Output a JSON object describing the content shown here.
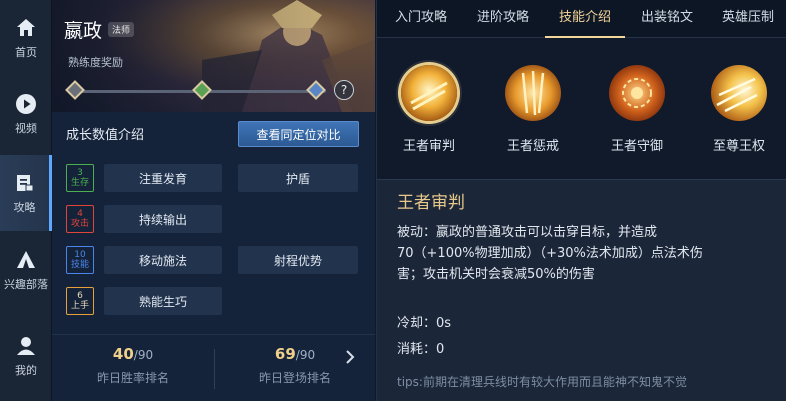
{
  "nav": {
    "items": [
      {
        "label": "首页",
        "icon": "home-icon"
      },
      {
        "label": "视频",
        "icon": "play-icon"
      },
      {
        "label": "攻略",
        "icon": "guide-icon"
      },
      {
        "label": "兴趣部落",
        "icon": "tribe-icon"
      },
      {
        "label": "我的",
        "icon": "user-icon"
      }
    ],
    "active": "攻略"
  },
  "hero": {
    "name": "嬴政",
    "role": "法师",
    "proficiency_label": "熟练度奖励",
    "help": "?"
  },
  "growth": {
    "title": "成长数值介绍",
    "compare_button": "查看同定位对比",
    "rows": [
      {
        "level": "3",
        "level_tag": "生存",
        "color": "#4caf50",
        "skills": [
          "注重发育",
          "护盾"
        ]
      },
      {
        "level": "4",
        "level_tag": "攻击",
        "color": "#e0453a",
        "skills": [
          "持续输出"
        ]
      },
      {
        "level": "10",
        "level_tag": "技能",
        "color": "#4a86e8",
        "skills": [
          "移动施法",
          "射程优势"
        ]
      },
      {
        "level": "6",
        "level_tag": "上手",
        "color": "#e8a13a",
        "skills": [
          "熟能生巧"
        ]
      }
    ]
  },
  "ranks": [
    {
      "value": "40",
      "total": "/90",
      "caption": "昨日胜率排名"
    },
    {
      "value": "69",
      "total": "/90",
      "caption": "昨日登场排名"
    }
  ],
  "tabs": [
    "入门攻略",
    "进阶攻略",
    "技能介绍",
    "出装铭文",
    "英雄压制"
  ],
  "active_tab": "技能介绍",
  "skills": [
    {
      "name": "王者审判",
      "icon": "skill-judgment-icon"
    },
    {
      "name": "王者惩戒",
      "icon": "skill-punish-icon"
    },
    {
      "name": "王者守御",
      "icon": "skill-guard-icon"
    },
    {
      "name": "至尊王权",
      "icon": "skill-supreme-icon"
    }
  ],
  "skill_detail": {
    "title": "王者审判",
    "desc_line1": "被动：嬴政的普通攻击可以击穿目标，并造成",
    "desc_line2": "70（+100%物理加成）（+30%法术加成）点法术伤",
    "desc_line3": "害；攻击机关时会衰减50%的伤害",
    "cooldown": "冷却：0s",
    "cost": "消耗：0",
    "tips": "tips:前期在清理兵线时有较大作用而且能神不知鬼不觉"
  },
  "colors": {
    "accent": "#f3d699",
    "button": "#3f74b6",
    "panel": "#15233a"
  }
}
